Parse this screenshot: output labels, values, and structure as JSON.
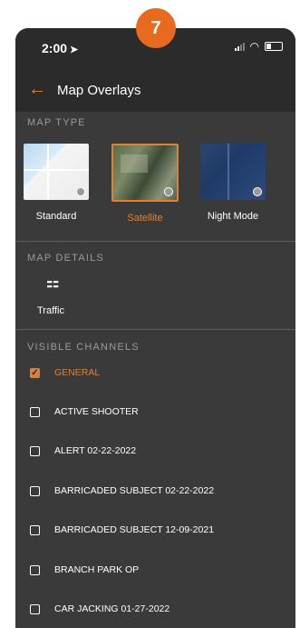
{
  "step_badge": "7",
  "status_bar": {
    "time": "2:00",
    "location_icon": "location-arrow-icon"
  },
  "nav": {
    "back_icon": "back-arrow-icon",
    "title": "Map Overlays"
  },
  "map_type": {
    "heading": "MAP TYPE",
    "options": [
      {
        "label": "Standard",
        "selected": false
      },
      {
        "label": "Satellite",
        "selected": true
      },
      {
        "label": "Night Mode",
        "selected": false
      }
    ]
  },
  "map_details": {
    "heading": "MAP DETAILS",
    "traffic": {
      "icon": "traffic-light-icon",
      "label": "Traffic"
    }
  },
  "visible_channels": {
    "heading": "VISIBLE CHANNELS",
    "items": [
      {
        "label": "GENERAL",
        "checked": true
      },
      {
        "label": "ACTIVE SHOOTER",
        "checked": false
      },
      {
        "label": "ALERT 02-22-2022",
        "checked": false
      },
      {
        "label": "BARRICADED SUBJECT 02-22-2022",
        "checked": false
      },
      {
        "label": "BARRICADED SUBJECT 12-09-2021",
        "checked": false
      },
      {
        "label": "BRANCH PARK OP",
        "checked": false
      },
      {
        "label": "CAR JACKING 01-27-2022",
        "checked": false
      }
    ]
  },
  "colors": {
    "accent": "#e08033",
    "background": "#3a3a3a",
    "header": "#2b2b2b",
    "badge": "#e86a1f"
  }
}
